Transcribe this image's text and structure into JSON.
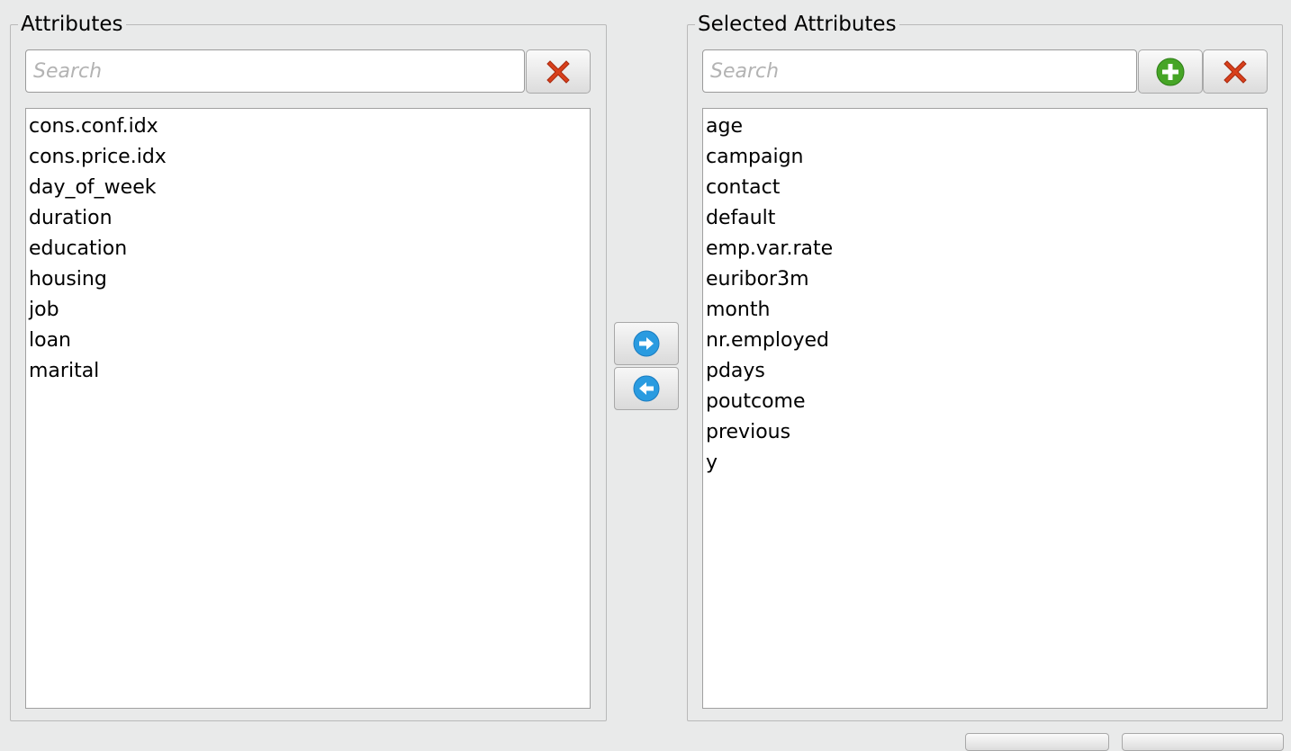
{
  "left_panel": {
    "title": "Attributes",
    "search": {
      "placeholder": "Search",
      "value": ""
    },
    "clear_button_icon": "close-x-icon",
    "items": [
      "cons.conf.idx",
      "cons.price.idx",
      "day_of_week",
      "duration",
      "education",
      "housing",
      "job",
      "loan",
      "marital"
    ]
  },
  "transfer_buttons": {
    "move_right_icon": "arrow-right-icon",
    "move_left_icon": "arrow-left-icon"
  },
  "right_panel": {
    "title": "Selected Attributes",
    "search": {
      "placeholder": "Search",
      "value": ""
    },
    "add_button_icon": "plus-icon",
    "clear_button_icon": "close-x-icon",
    "items": [
      "age",
      "campaign",
      "contact",
      "default",
      "emp.var.rate",
      "euribor3m",
      "month",
      "nr.employed",
      "pdays",
      "poutcome",
      "previous",
      "y"
    ]
  },
  "colors": {
    "background": "#e9eaea",
    "x_icon": "#d8401c",
    "plus_icon": "#46a526",
    "arrow_icon": "#2a9be0"
  }
}
